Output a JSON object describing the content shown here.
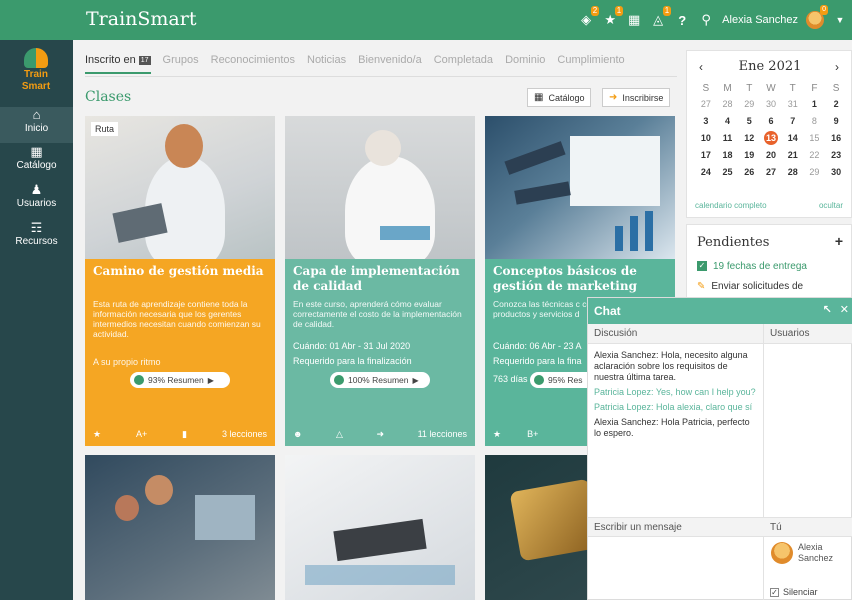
{
  "app": {
    "title": "TrainSmart",
    "user_name": "Alexia Sanchez",
    "logo_text_1": "Train",
    "logo_text_2": "Smart",
    "accent_color": "#3b9a6d",
    "brand_orange": "#f39c12"
  },
  "topbar": {
    "icons": [
      {
        "name": "badge-icon",
        "badge": "2"
      },
      {
        "name": "trophy-icon",
        "badge": "1"
      },
      {
        "name": "grid-icon",
        "badge": ""
      },
      {
        "name": "cart-icon",
        "badge": "1"
      },
      {
        "name": "help-icon",
        "badge": ""
      }
    ],
    "search_icon": "search-icon",
    "avatar_badge": "0"
  },
  "sidebar": {
    "items": [
      {
        "label": "Inicio",
        "icon": "home-icon"
      },
      {
        "label": "Catálogo",
        "icon": "catalog-icon"
      },
      {
        "label": "Usuarios",
        "icon": "users-icon"
      },
      {
        "label": "Recursos",
        "icon": "resources-icon"
      }
    ]
  },
  "tabs": [
    {
      "label": "Inscrito en",
      "badge": "17"
    },
    {
      "label": "Grupos"
    },
    {
      "label": "Reconocimientos"
    },
    {
      "label": "Noticias"
    },
    {
      "label": "Bienvenido/a"
    },
    {
      "label": "Completada"
    },
    {
      "label": "Dominio"
    },
    {
      "label": "Cumplimiento"
    }
  ],
  "section": {
    "title": "Clases",
    "catalog_button": "Catálogo",
    "enroll_button": "Inscribirse"
  },
  "cards": [
    {
      "tag": "Ruta",
      "title": "Camino de gestión media",
      "description": "Esta ruta de aprendizaje contiene toda la información necesaria que los gerentes intermedios necesitan cuando comienzan su actividad.",
      "line1": "A su propio ritmo",
      "progress": "93% Resumen",
      "foot_left": "A+",
      "foot_right": "3 lecciones"
    },
    {
      "title": "Capa de implementación de calidad",
      "description": "En este curso, aprenderá cómo evaluar correctamente el costo de la implementación de calidad.",
      "line1": "Cuándo: 01 Abr - 31 Jul 2020",
      "line2": "Requerido para la finalización",
      "progress": "100% Resumen",
      "foot_right": "11 lecciones"
    },
    {
      "title": "Conceptos básicos de gestión de marketing",
      "description": "Conozca las técnicas c comprender las compl productos y servicios d",
      "line1": "Cuándo: 06 Abr - 23 A",
      "line2": "Requerido para la fina",
      "line3": "763 días restantes",
      "progress": "95% Res",
      "foot_left": "B+"
    }
  ],
  "calendar": {
    "month": "Ene 2021",
    "day_names": [
      "S",
      "M",
      "T",
      "W",
      "T",
      "F",
      "S"
    ],
    "weeks": [
      [
        "27",
        "28",
        "29",
        "30",
        "31",
        "1",
        "2"
      ],
      [
        "3",
        "4",
        "5",
        "6",
        "7",
        "8",
        "9"
      ],
      [
        "10",
        "11",
        "12",
        "13",
        "14",
        "15",
        "16"
      ],
      [
        "17",
        "18",
        "19",
        "20",
        "21",
        "22",
        "23"
      ],
      [
        "24",
        "25",
        "26",
        "27",
        "28",
        "29",
        "30"
      ]
    ],
    "today": "13",
    "full_link": "calendario completo",
    "hide_link": "ocultar"
  },
  "pending": {
    "title": "Pendientes",
    "items": [
      {
        "text": "19 fechas de entrega"
      },
      {
        "text": "Enviar solicitudes de"
      }
    ]
  },
  "chat": {
    "title": "Chat",
    "col_discussion": "Discusión",
    "col_users": "Usuarios",
    "messages": [
      {
        "author": "Alexia Sanchez",
        "text": "Hola, necesito alguna aclaración sobre los requisitos de nuestra última tarea.",
        "mine": true
      },
      {
        "author": "Patricia Lopez",
        "text": "Yes, how can I help you?",
        "mine": false
      },
      {
        "author": "Patricia Lopez",
        "text": "Hola alexia, claro que sí",
        "mine": false
      },
      {
        "author": "Alexia Sanchez",
        "text": "Hola Patricia, perfecto lo espero.",
        "mine": true
      }
    ],
    "input_placeholder": "Escribir un mensaje",
    "you_label": "Tú",
    "me_first": "Alexia",
    "me_last": "Sanchez",
    "mute_label": "Silenciar"
  }
}
